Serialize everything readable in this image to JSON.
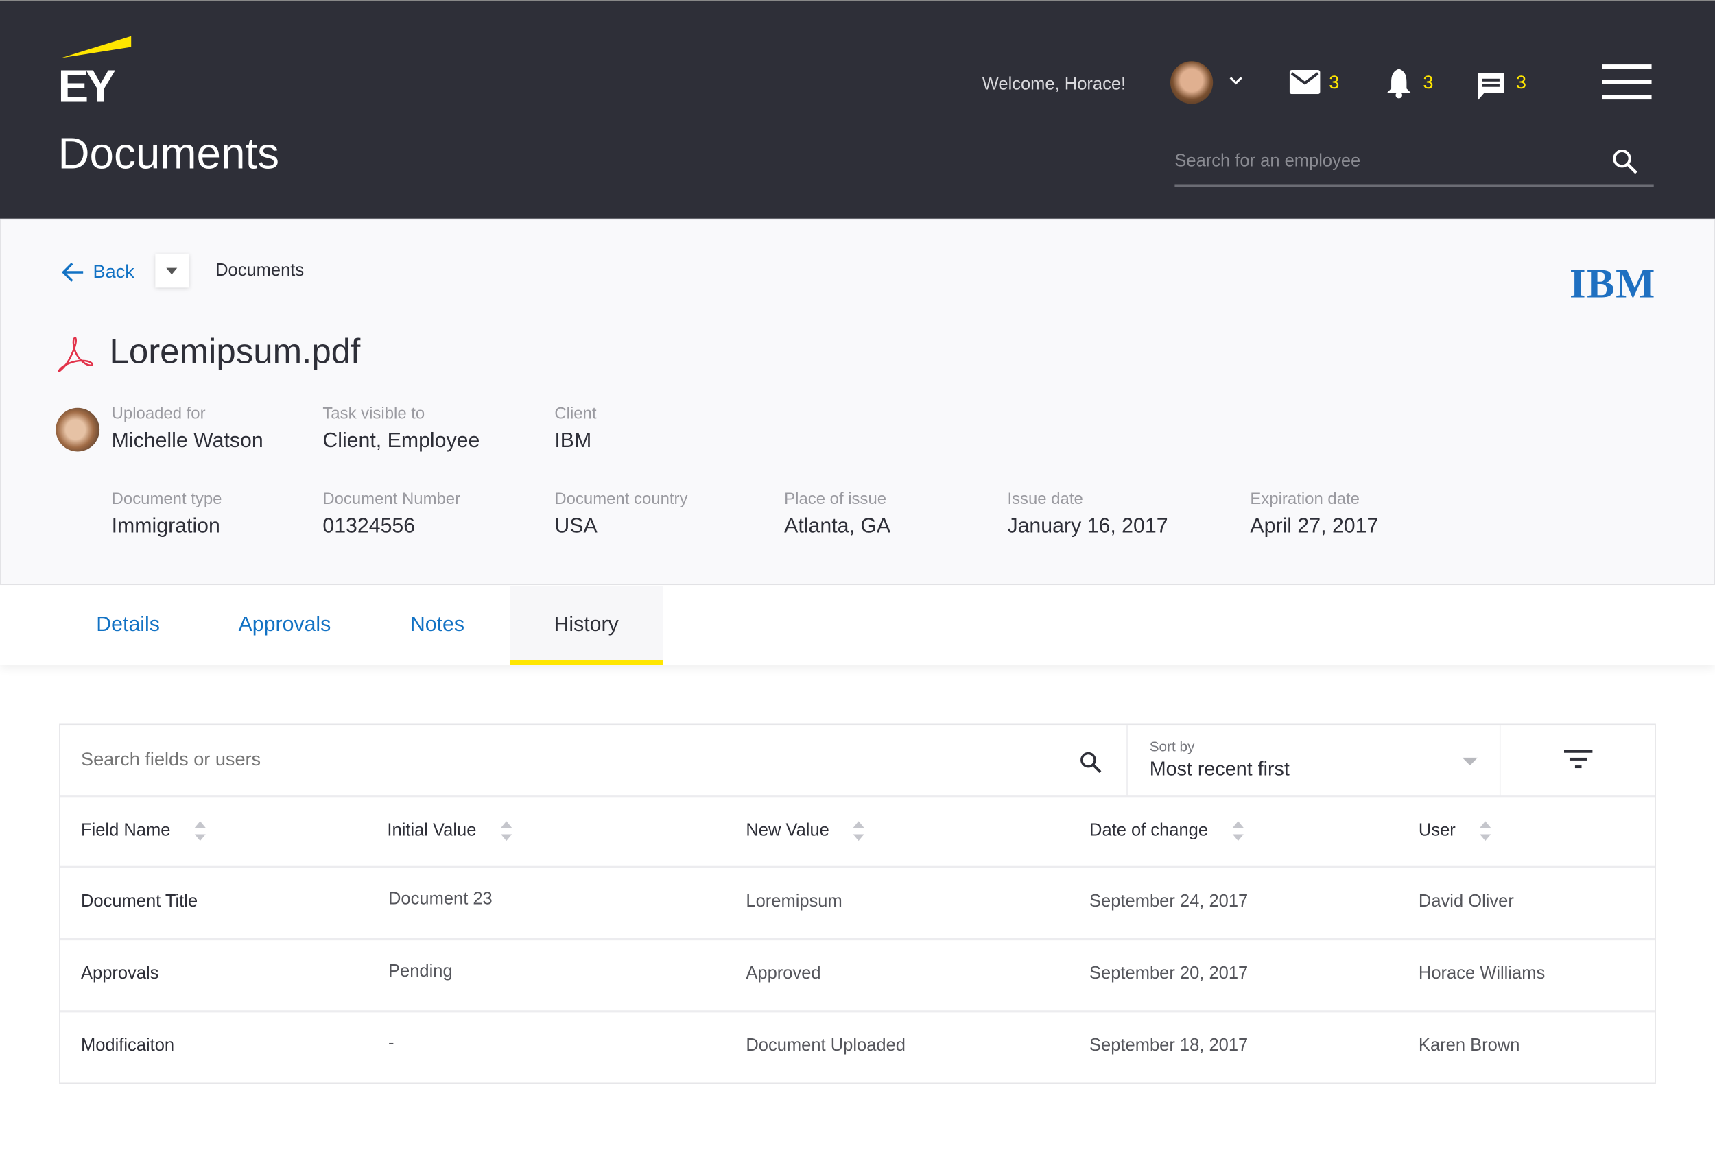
{
  "header": {
    "logo_text": "EY",
    "title": "Documents",
    "welcome": "Welcome, Horace!",
    "mail_count": "3",
    "notification_count": "3",
    "chat_count": "3",
    "search_placeholder": "Search for an employee"
  },
  "breadcrumb": {
    "back_label": "Back",
    "current": "Documents"
  },
  "client_logo": "IBM",
  "document": {
    "filename": "Loremipsum.pdf",
    "fields_row1": [
      {
        "label": "Uploaded for",
        "value": "Michelle Watson"
      },
      {
        "label": "Task visible to",
        "value": "Client, Employee"
      },
      {
        "label": "Client",
        "value": "IBM"
      }
    ],
    "fields_row2": [
      {
        "label": "Document type",
        "value": "Immigration"
      },
      {
        "label": "Document Number",
        "value": "01324556"
      },
      {
        "label": "Document country",
        "value": "USA"
      },
      {
        "label": "Place of issue",
        "value": "Atlanta, GA"
      },
      {
        "label": "Issue date",
        "value": "January 16, 2017"
      },
      {
        "label": "Expiration date",
        "value": "April 27, 2017"
      }
    ]
  },
  "tabs": [
    {
      "label": "Details"
    },
    {
      "label": "Approvals"
    },
    {
      "label": "Notes"
    },
    {
      "label": "History",
      "active": true
    }
  ],
  "history": {
    "search_placeholder": "Search fields or users",
    "sort_label": "Sort by",
    "sort_value": "Most recent first",
    "columns": [
      "Field Name",
      "Initial Value",
      "New Value",
      "Date of change",
      "User"
    ],
    "rows": [
      [
        "Document Title",
        "Document 23",
        "Loremipsum",
        "September 24, 2017",
        "David Oliver"
      ],
      [
        "Approvals",
        "Pending",
        "Approved",
        "September 20, 2017",
        "Horace Williams"
      ],
      [
        "Modificaiton",
        "-",
        "Document Uploaded",
        "September 18, 2017",
        "Karen Brown"
      ]
    ]
  },
  "colors": {
    "header_bg": "#2e2f38",
    "accent_yellow": "#ffe600",
    "link_blue": "#1272c4",
    "ibm_blue": "#1f70c1",
    "pdf_red": "#e2334a"
  }
}
